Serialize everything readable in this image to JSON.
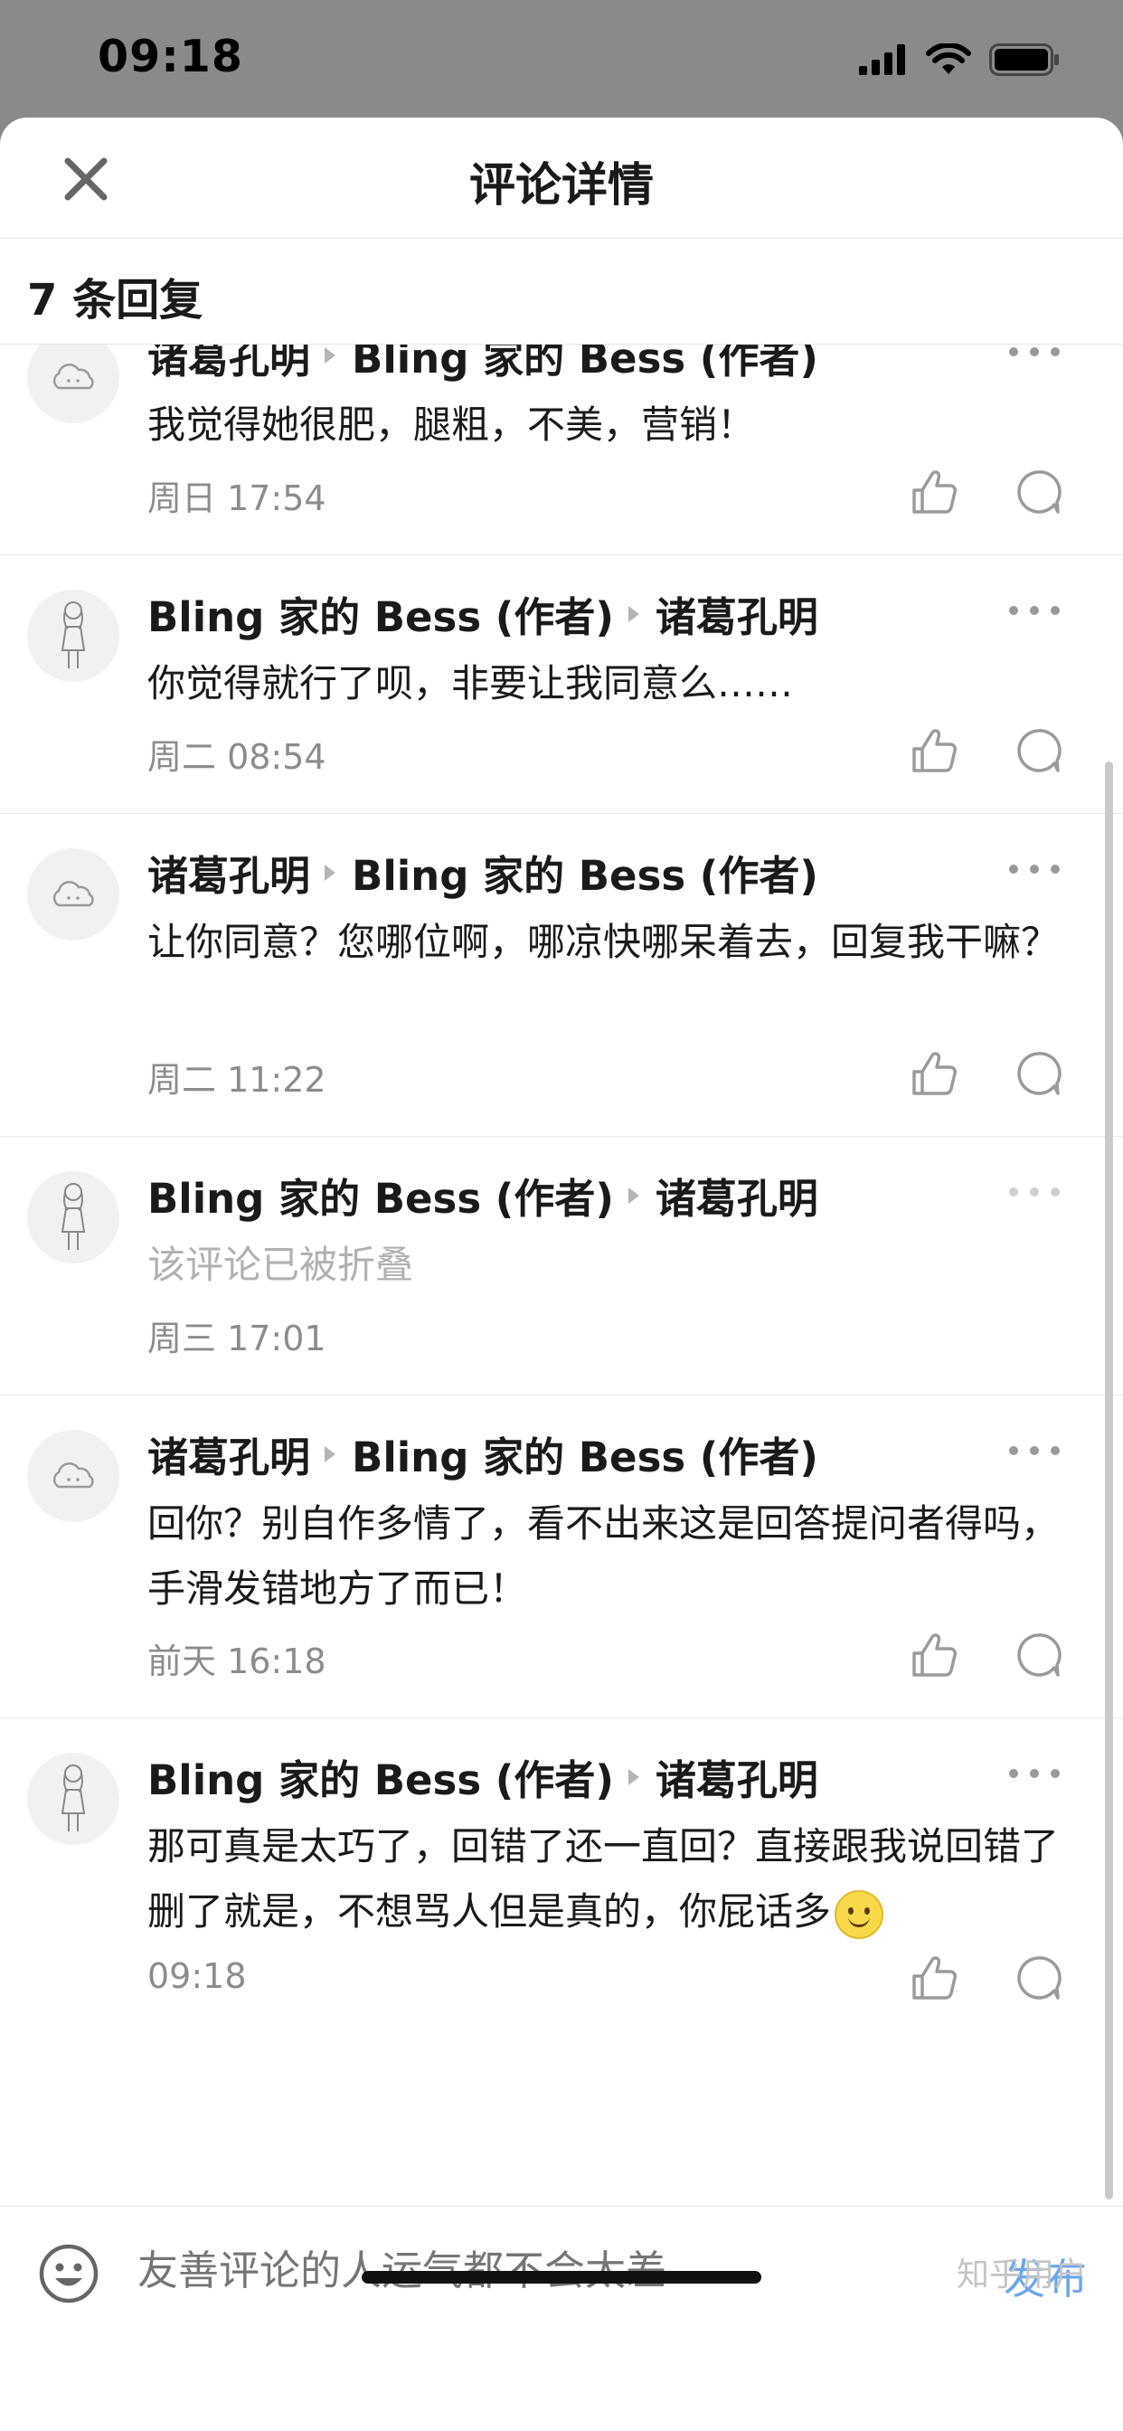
{
  "status_bar": {
    "time": "09:18"
  },
  "header": {
    "title": "评论详情"
  },
  "reply_count": "7 条回复",
  "comments": [
    {
      "author": "诸葛孔明",
      "reply_to": "Bling 家的 Bess (作者)",
      "text": "我觉得她很肥，腿粗，不美，营销！",
      "time": "周日 17:54",
      "avatar": "cloud"
    },
    {
      "author": "Bling 家的 Bess (作者)",
      "reply_to": "诸葛孔明",
      "text": "你觉得就行了呗，非要让我同意么……",
      "time": "周二 08:54",
      "avatar": "girl"
    },
    {
      "author": "诸葛孔明",
      "reply_to": "Bling 家的 Bess (作者)",
      "text": "让你同意？您哪位啊，哪凉快哪呆着去，回复我干嘛？",
      "time": "周二 11:22",
      "avatar": "cloud"
    },
    {
      "author": "Bling 家的 Bess (作者)",
      "reply_to": "诸葛孔明",
      "text": "该评论已被折叠",
      "time": "周三 17:01",
      "avatar": "girl",
      "folded": true
    },
    {
      "author": "诸葛孔明",
      "reply_to": "Bling 家的 Bess (作者)",
      "text": "回你？别自作多情了，看不出来这是回答提问者得吗，手滑发错地方了而已！",
      "time": "前天 16:18",
      "avatar": "cloud"
    },
    {
      "author": "Bling 家的 Bess (作者)",
      "reply_to": "诸葛孔明",
      "text": "那可真是太巧了，回错了还一直回？直接跟我说回错了删了就是，不想骂人但是真的，你屁话多",
      "time": "09:18",
      "avatar": "girl",
      "emoji": "slightly-smiling-face"
    }
  ],
  "input": {
    "placeholder": "友善评论的人运气都不会太差",
    "publish_label": "发布"
  },
  "watermark": "知乎用户",
  "colors": {
    "publish": "#6aa8ea",
    "muted": "#8c8c8c",
    "folded": "#b0b0b0"
  }
}
